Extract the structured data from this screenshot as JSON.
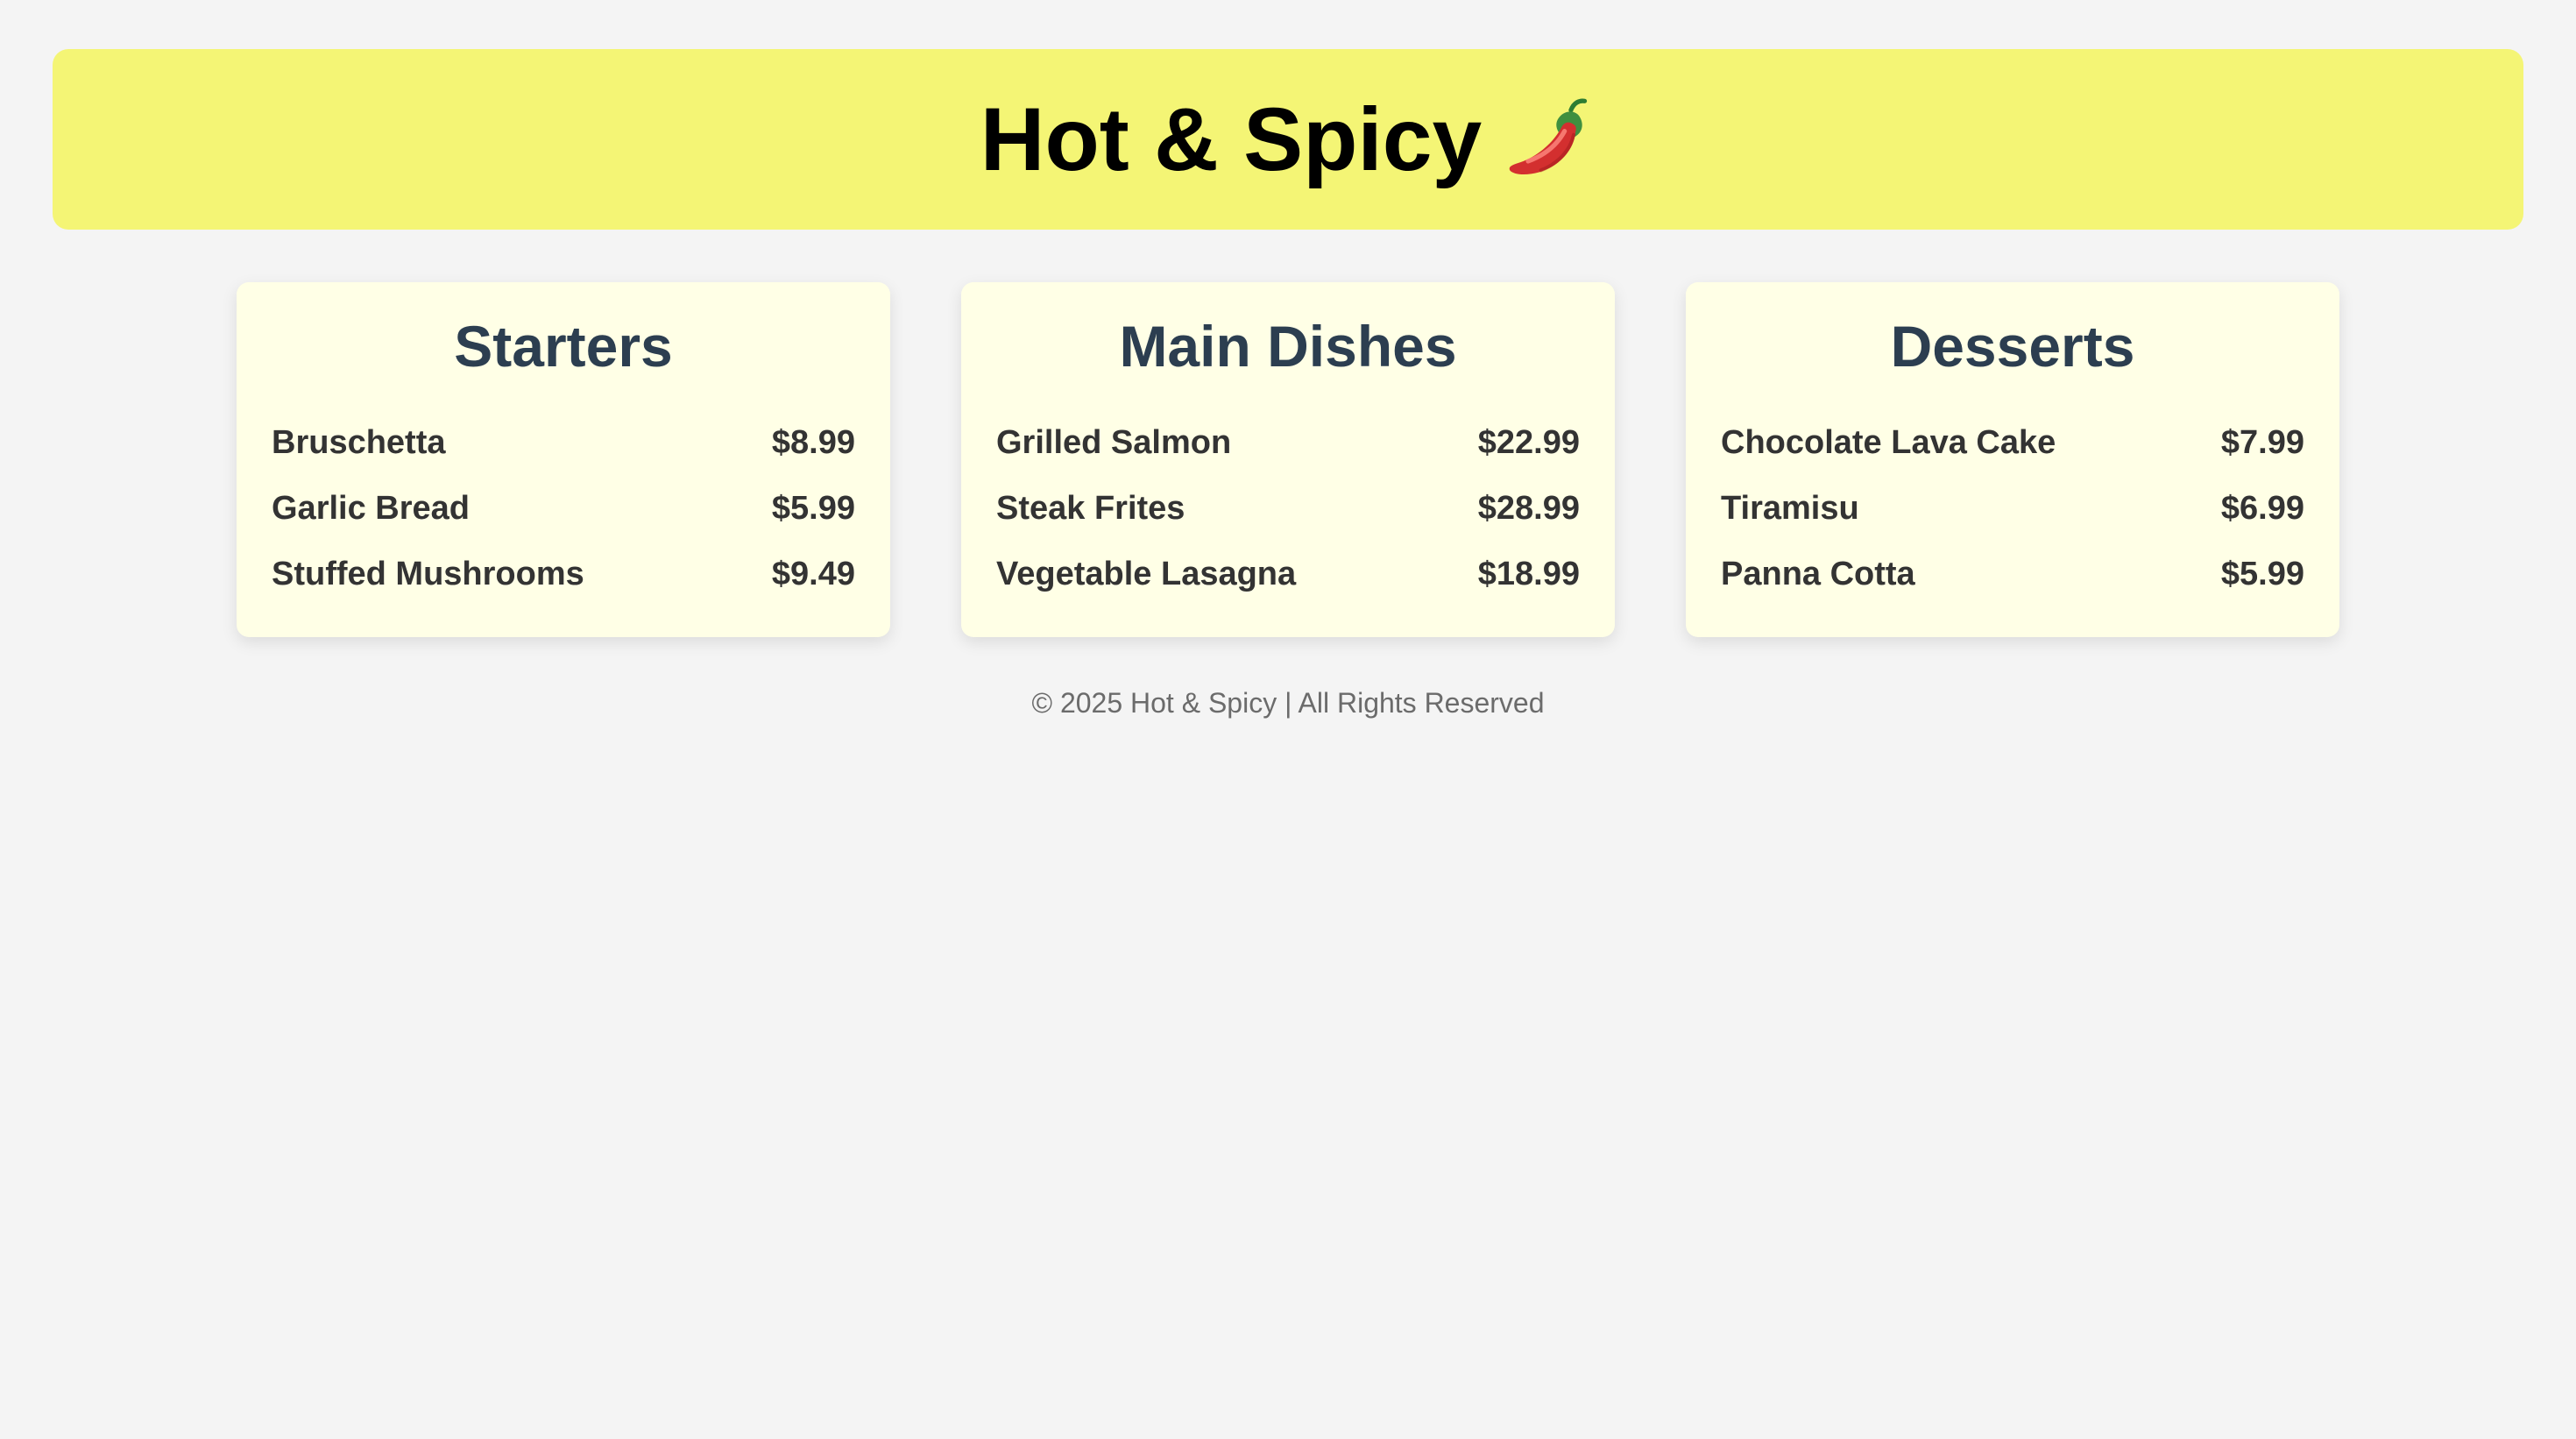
{
  "header": {
    "title": "Hot & Spicy",
    "emoji_icon": "chili-pepper-icon",
    "background": "#f4f575"
  },
  "menu": {
    "sections": [
      {
        "title": "Starters",
        "items": [
          {
            "name": "Bruschetta",
            "price": "$8.99"
          },
          {
            "name": "Garlic Bread",
            "price": "$5.99"
          },
          {
            "name": "Stuffed Mushrooms",
            "price": "$9.49"
          }
        ]
      },
      {
        "title": "Main Dishes",
        "items": [
          {
            "name": "Grilled Salmon",
            "price": "$22.99"
          },
          {
            "name": "Steak Frites",
            "price": "$28.99"
          },
          {
            "name": "Vegetable Lasagna",
            "price": "$18.99"
          }
        ]
      },
      {
        "title": "Desserts",
        "items": [
          {
            "name": "Chocolate Lava Cake",
            "price": "$7.99"
          },
          {
            "name": "Tiramisu",
            "price": "$6.99"
          },
          {
            "name": "Panna Cotta",
            "price": "$5.99"
          }
        ]
      }
    ]
  },
  "footer": {
    "text": "© 2025 Hot & Spicy | All Rights Reserved"
  },
  "colors": {
    "page_background": "#f4f4f4",
    "card_background": "#ffffe6",
    "section_title": "#2c3e50",
    "item_text": "#333333",
    "footer_text": "#6b6b6b"
  }
}
